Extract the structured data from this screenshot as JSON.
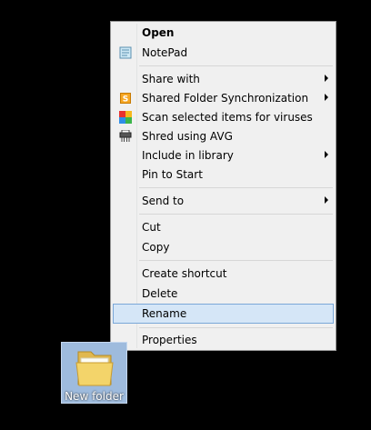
{
  "menu": {
    "items": [
      {
        "id": "open",
        "label": "Open",
        "bold": true,
        "icon": null,
        "submenu": false
      },
      {
        "id": "notepad",
        "label": "NotePad",
        "bold": false,
        "icon": "notepad-icon",
        "submenu": false
      },
      {
        "id": "share-with",
        "label": "Share with",
        "bold": false,
        "icon": null,
        "submenu": true
      },
      {
        "id": "shared-folder-sync",
        "label": "Shared Folder Synchronization",
        "bold": false,
        "icon": "sync-icon",
        "submenu": true
      },
      {
        "id": "scan-viruses",
        "label": "Scan selected items for viruses",
        "bold": false,
        "icon": "avg-icon",
        "submenu": false
      },
      {
        "id": "shred-avg",
        "label": "Shred using AVG",
        "bold": false,
        "icon": "shredder-icon",
        "submenu": false
      },
      {
        "id": "include-library",
        "label": "Include in library",
        "bold": false,
        "icon": null,
        "submenu": true
      },
      {
        "id": "pin-start",
        "label": "Pin to Start",
        "bold": false,
        "icon": null,
        "submenu": false
      },
      {
        "id": "send-to",
        "label": "Send to",
        "bold": false,
        "icon": null,
        "submenu": true
      },
      {
        "id": "cut",
        "label": "Cut",
        "bold": false,
        "icon": null,
        "submenu": false
      },
      {
        "id": "copy",
        "label": "Copy",
        "bold": false,
        "icon": null,
        "submenu": false
      },
      {
        "id": "create-shortcut",
        "label": "Create shortcut",
        "bold": false,
        "icon": null,
        "submenu": false
      },
      {
        "id": "delete",
        "label": "Delete",
        "bold": false,
        "icon": null,
        "submenu": false
      },
      {
        "id": "rename",
        "label": "Rename",
        "bold": false,
        "icon": null,
        "submenu": false,
        "highlighted": true
      },
      {
        "id": "properties",
        "label": "Properties",
        "bold": false,
        "icon": null,
        "submenu": false
      }
    ]
  },
  "desktop": {
    "folder_name": "New folder"
  },
  "colors": {
    "highlight_bg": "#d5e6f7",
    "highlight_border": "#7aa7d8",
    "menu_bg": "#f0f0f0"
  }
}
